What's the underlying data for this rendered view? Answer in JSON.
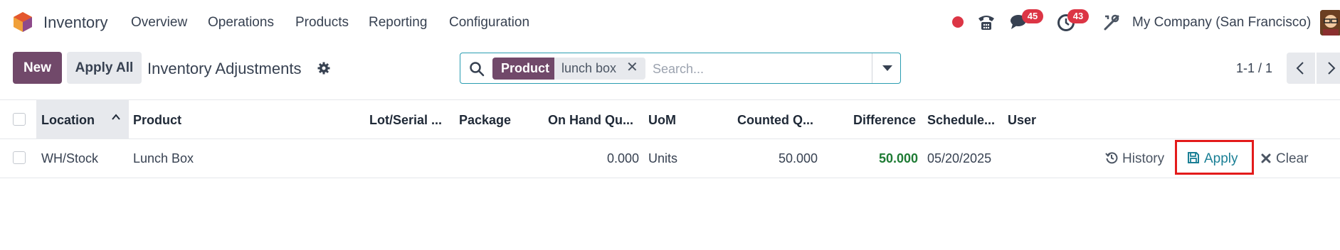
{
  "navbar": {
    "app_name": "Inventory",
    "menu": [
      "Overview",
      "Operations",
      "Products",
      "Reporting",
      "Configuration"
    ],
    "chat_badge": "45",
    "activity_badge": "43",
    "company": "My Company (San Francisco)"
  },
  "control": {
    "new_label": "New",
    "apply_all_label": "Apply All",
    "title": "Inventory Adjustments",
    "search": {
      "facet_label": "Product",
      "facet_value": "lunch box",
      "placeholder": "Search..."
    },
    "pager": "1-1 / 1"
  },
  "list": {
    "columns": [
      "Location",
      "Product",
      "Lot/Serial ...",
      "Package",
      "On Hand Qu...",
      "UoM",
      "Counted Q...",
      "Difference",
      "Schedule...",
      "User"
    ],
    "rows": [
      {
        "location": "WH/Stock",
        "product": "Lunch Box",
        "lot": "",
        "package": "",
        "on_hand": "0.000",
        "uom": "Units",
        "counted": "50.000",
        "difference": "50.000",
        "scheduled": "05/20/2025",
        "user": "",
        "actions": {
          "history": "History",
          "apply": "Apply",
          "clear": "Clear"
        }
      }
    ]
  },
  "colors": {
    "brand": "#71496a",
    "badge": "#dc3545",
    "accent": "#1a7f95",
    "positive": "#1e7b34",
    "highlight": "#e31b1b"
  },
  "icons": [
    "app-logo-icon",
    "record-icon",
    "phone-icon",
    "chat-icon",
    "clock-icon",
    "tools-icon",
    "gear-icon",
    "search-icon",
    "close-icon",
    "caret-down-icon",
    "chevron-left-icon",
    "chevron-right-icon",
    "sort-up-icon",
    "history-icon",
    "save-icon",
    "x-icon"
  ]
}
